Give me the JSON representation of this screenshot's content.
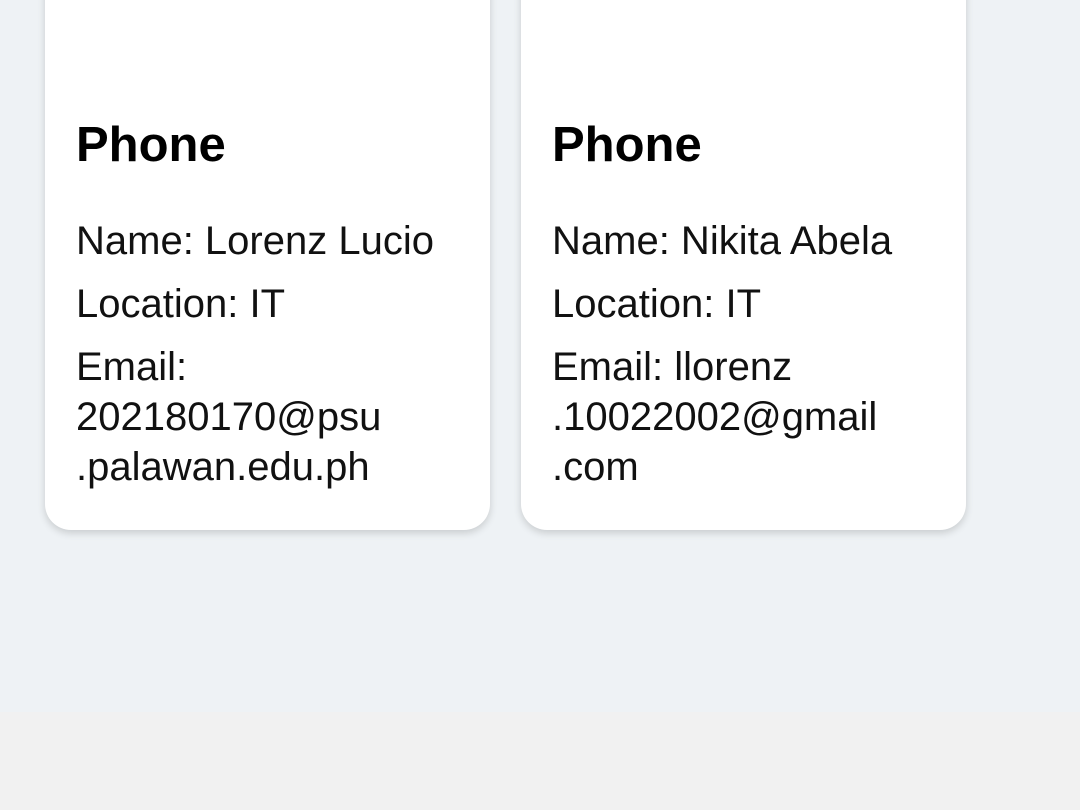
{
  "cards": [
    {
      "title": "Phone",
      "name_line": "Name: Lorenz Lucio",
      "location_line": "Location: IT",
      "email_lines": [
        "Email:",
        "202180170@psu",
        ".palawan.edu.ph"
      ]
    },
    {
      "title": "Phone",
      "name_line": "Name: Nikita Abela",
      "location_line": "Location: IT",
      "email_lines": [
        "Email: llorenz",
        ".10022002@gmail",
        ".com"
      ]
    }
  ],
  "colors": {
    "page_background": "#eef2f5",
    "card_background": "#ffffff",
    "bottom_bar": "#f1f1f1",
    "title_text": "#000000",
    "body_text": "#111111"
  }
}
